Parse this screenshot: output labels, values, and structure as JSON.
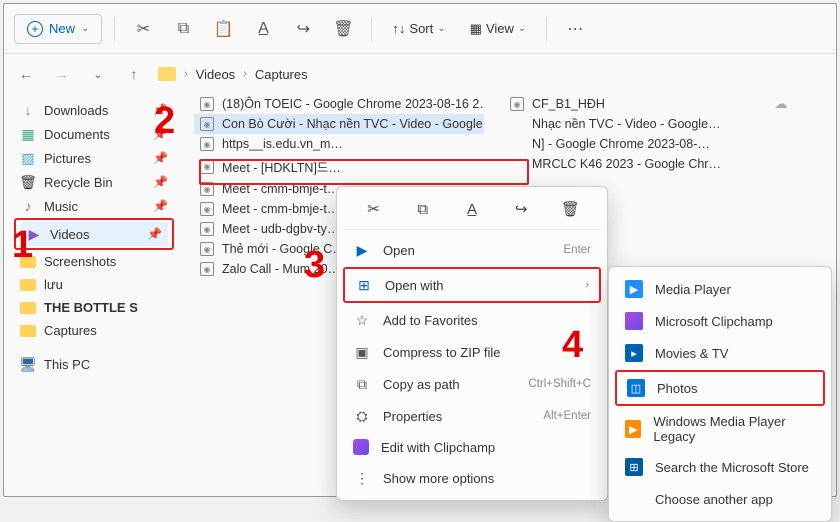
{
  "toolbar": {
    "new_label": "New",
    "sort_label": "Sort",
    "view_label": "View"
  },
  "breadcrumb": {
    "seg1": "Videos",
    "seg2": "Captures"
  },
  "sidebar": {
    "items": [
      {
        "label": "Downloads",
        "icon": "↓",
        "pin": true
      },
      {
        "label": "Documents",
        "icon": "▦",
        "pin": true
      },
      {
        "label": "Pictures",
        "icon": "▨",
        "pin": true
      },
      {
        "label": "Recycle Bin",
        "icon": "🗑",
        "pin": true
      },
      {
        "label": "Music",
        "icon": "♪",
        "pin": true
      },
      {
        "label": "Videos",
        "icon": "▶",
        "pin": true
      },
      {
        "label": "Screenshots",
        "icon": "fol",
        "pin": false
      },
      {
        "label": "lưu",
        "icon": "fol",
        "pin": false
      },
      {
        "label": "THE BOTTLE S",
        "icon": "fol",
        "pin": false,
        "bold": true
      },
      {
        "label": "Captures",
        "icon": "fol",
        "pin": false
      }
    ],
    "footer": "This PC"
  },
  "files_left": [
    "(18)Ôn TOEIC - Google Chrome 2023-08-16 2…",
    "Con Bò Cười - Nhạc nền TVC - Video - Google…",
    "https__is.edu.vn_m…",
    "Meet - [HDKLTN]드…",
    "Meet - cmm-bmje-t…",
    "Meet - cmm-bmje-t…",
    "Meet - udb-dgbv-ty…",
    "Thẻ mới - Google C…",
    "Zalo Call - Mum 20…"
  ],
  "files_right": [
    "CF_B1_HĐH",
    "Nhạc nền TVC - Video - Google…",
    "N]  - Google Chrome 2023-08-…",
    "MRCLC K46 2023 - Google Chr…"
  ],
  "ctx": {
    "open": "Open",
    "open_hint": "Enter",
    "openwith": "Open with",
    "fav": "Add to Favorites",
    "zip": "Compress to ZIP file",
    "copy": "Copy as path",
    "copy_hint": "Ctrl+Shift+C",
    "prop": "Properties",
    "prop_hint": "Alt+Enter",
    "clip": "Edit with Clipchamp",
    "more": "Show more options"
  },
  "submenu": {
    "items": [
      "Media Player",
      "Microsoft Clipchamp",
      "Movies & TV",
      "Photos",
      "Windows Media Player Legacy",
      "Search the Microsoft Store",
      "Choose another app"
    ]
  },
  "anno": {
    "n1": "1",
    "n2": "2",
    "n3": "3",
    "n4": "4"
  }
}
